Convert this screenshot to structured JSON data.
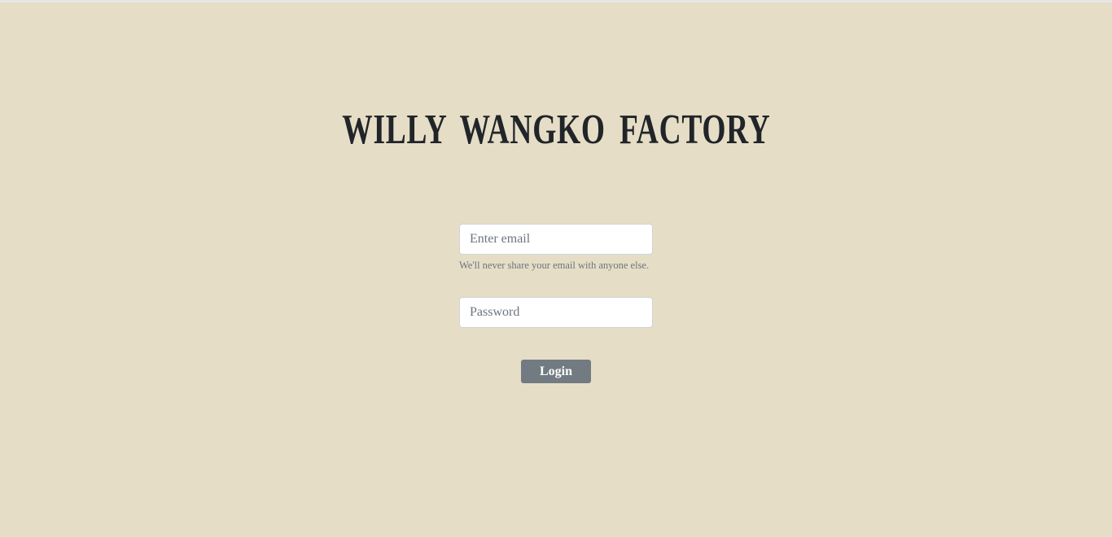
{
  "header": {
    "title": "WILLY WANGKO FACTORY"
  },
  "login_form": {
    "email": {
      "placeholder": "Enter email",
      "value": "",
      "help_text": "We'll never share your email with anyone else."
    },
    "password": {
      "placeholder": "Password",
      "value": ""
    },
    "submit_label": "Login"
  },
  "colors": {
    "background": "#e5ddc6",
    "title": "#212529",
    "button": "#737b82",
    "help_text": "#6c757d"
  }
}
